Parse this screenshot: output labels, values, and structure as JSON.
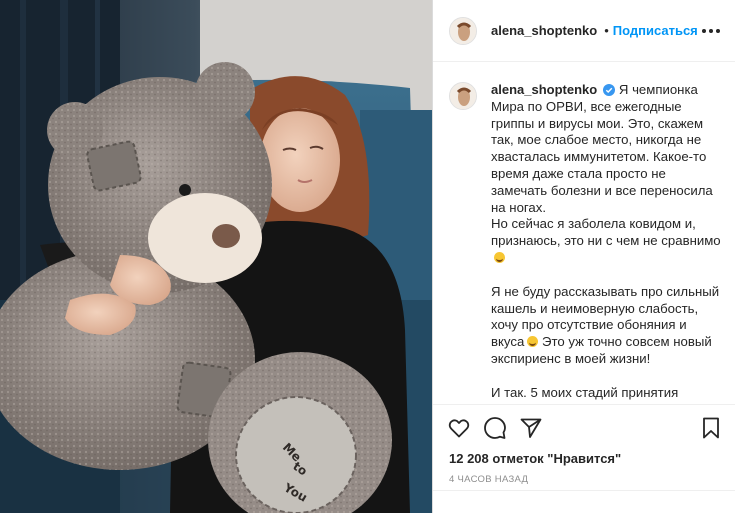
{
  "post": {
    "username": "alena_shoptenko",
    "verified": true,
    "follow_label": "Подписаться",
    "photo_text": [
      "Me",
      "to",
      "You"
    ],
    "caption": {
      "paragraphs": [
        "Я чемпионка Мира по ОРВИ, все ежегодные гриппы и вирусы мои. Это, скажем так, мое слабое место, никогда не хвасталась иммунитетом. Какое-то время даже стала просто не замечать болезни и все переносила на ногах.",
        "Но сейчас я заболела ковидом и, признаюсь, это ни с чем не сравнимо",
        "Я не буду рассказывать про сильный кашель и неимоверную слабость, хочу про отсутствие обоняния и вкуса",
        "Это уж точно совсем новый экспириенс в моей жизни!",
        "И так. 5 моих стадий принятия"
      ]
    },
    "likes_text": "12 208 отметок \"Нравится\"",
    "time_ago": "4 часов назад"
  },
  "icons": {
    "more": "more-dots-icon",
    "like": "heart-icon",
    "comment": "comment-icon",
    "share": "share-icon",
    "save": "bookmark-icon",
    "verified": "verified-badge-icon"
  },
  "colors": {
    "accent": "#0095f6",
    "verified": "#3897f0",
    "text": "#262626",
    "muted": "#8e8e8e"
  }
}
